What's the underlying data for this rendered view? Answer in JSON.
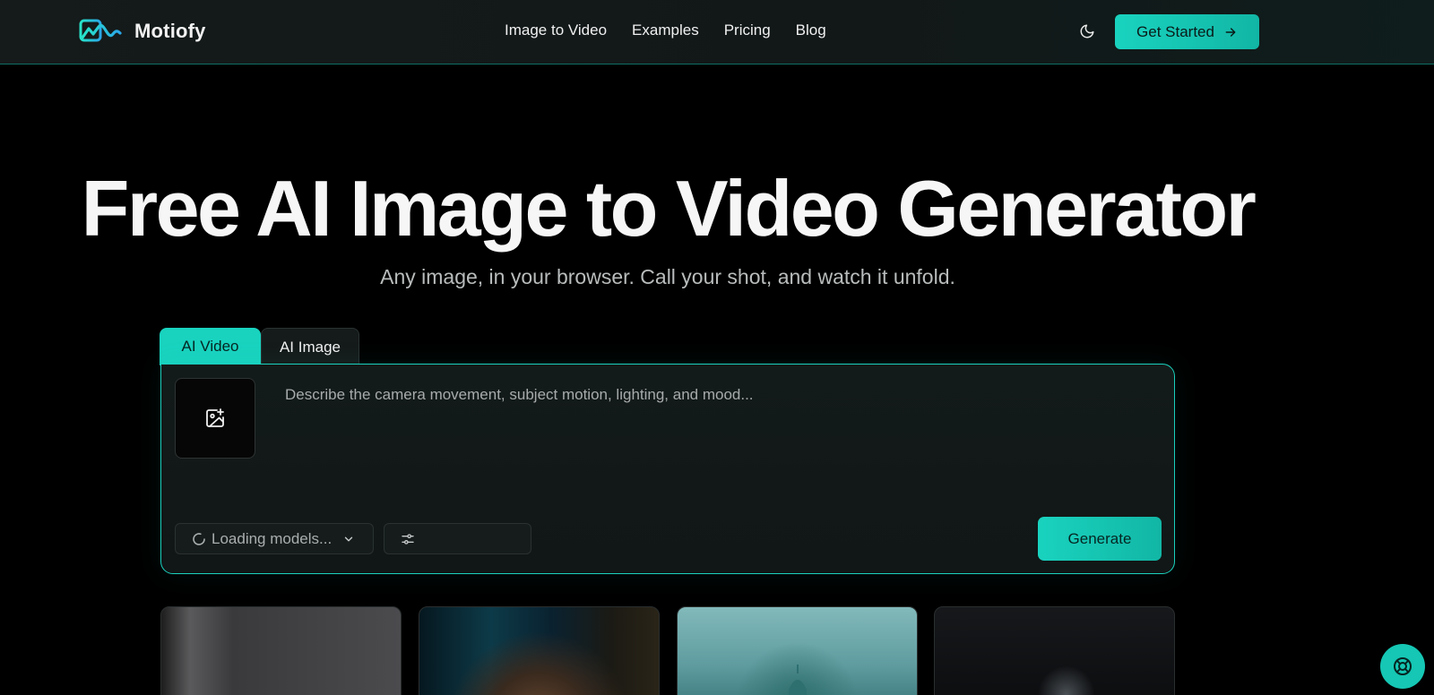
{
  "brand": {
    "name": "Motiofy"
  },
  "nav": {
    "items": [
      {
        "label": "Image to Video"
      },
      {
        "label": "Examples"
      },
      {
        "label": "Pricing"
      },
      {
        "label": "Blog"
      }
    ]
  },
  "header": {
    "cta_label": "Get Started",
    "theme_icon": "moon-icon",
    "cta_icon": "arrow-right-icon"
  },
  "hero": {
    "title": "Free AI Image to Video Generator",
    "subtitle": "Any image, in your browser. Call your shot, and watch it unfold."
  },
  "tabs": [
    {
      "label": "AI Video",
      "active": true
    },
    {
      "label": "AI Image",
      "active": false
    }
  ],
  "composer": {
    "upload_icon": "image-plus-icon",
    "prompt_placeholder": "Describe the camera movement, subject motion, lighting, and mood...",
    "prompt_value": "",
    "model_select_label": "Loading models...",
    "settings_icon": "sliders-icon",
    "generate_label": "Generate"
  },
  "colors": {
    "accent": "#19d3bf",
    "background": "#000000",
    "header": "#141a1a"
  },
  "help": {
    "icon": "lifebuoy-icon"
  }
}
